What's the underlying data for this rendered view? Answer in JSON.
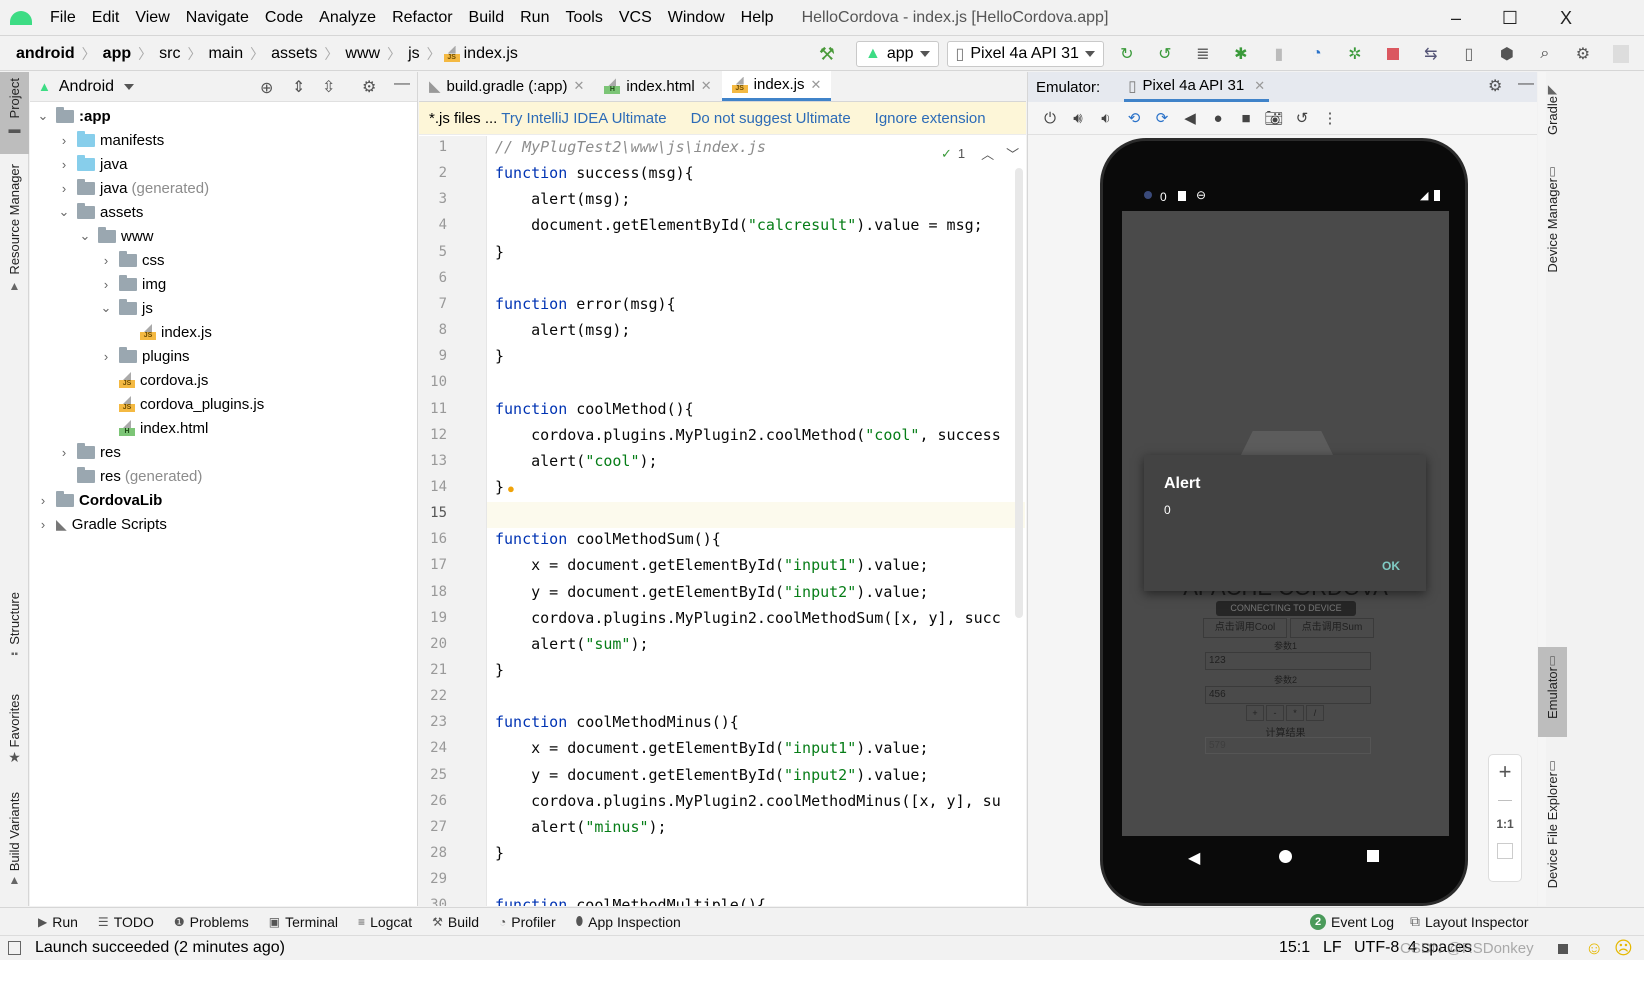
{
  "menu": [
    "File",
    "Edit",
    "View",
    "Navigate",
    "Code",
    "Analyze",
    "Refactor",
    "Build",
    "Run",
    "Tools",
    "VCS",
    "Window",
    "Help"
  ],
  "window_title": "HelloCordova - index.js [HelloCordova.app]",
  "window_controls": {
    "minimize": "–",
    "maximize": "☐",
    "close": "X"
  },
  "breadcrumb": [
    "android",
    "app",
    "src",
    "main",
    "assets",
    "www",
    "js",
    "index.js"
  ],
  "toolbar": {
    "run_config": "app",
    "device": "Pixel 4a API 31"
  },
  "left_stripe": {
    "project": "Project",
    "resource_manager": "Resource Manager",
    "structure": "Structure",
    "favorites": "Favorites",
    "build_variants": "Build Variants"
  },
  "project": {
    "view": "Android",
    "tree": [
      {
        "label": ":app",
        "level": 0,
        "chev": "v",
        "type": "module",
        "bold": true
      },
      {
        "label": "manifests",
        "level": 1,
        "chev": ">",
        "type": "blue"
      },
      {
        "label": "java",
        "level": 1,
        "chev": ">",
        "type": "blue"
      },
      {
        "label": "java",
        "suffix": "(generated)",
        "level": 1,
        "chev": ">",
        "type": "gen"
      },
      {
        "label": "assets",
        "level": 1,
        "chev": "v",
        "type": "res"
      },
      {
        "label": "www",
        "level": 2,
        "chev": "v",
        "type": "folder"
      },
      {
        "label": "css",
        "level": 3,
        "chev": ">",
        "type": "folder"
      },
      {
        "label": "img",
        "level": 3,
        "chev": ">",
        "type": "folder"
      },
      {
        "label": "js",
        "level": 3,
        "chev": "v",
        "type": "folder"
      },
      {
        "label": "index.js",
        "level": 4,
        "chev": "",
        "type": "js"
      },
      {
        "label": "plugins",
        "level": 3,
        "chev": ">",
        "type": "folder"
      },
      {
        "label": "cordova.js",
        "level": 3,
        "chev": "",
        "type": "js"
      },
      {
        "label": "cordova_plugins.js",
        "level": 3,
        "chev": "",
        "type": "js"
      },
      {
        "label": "index.html",
        "level": 3,
        "chev": "",
        "type": "html"
      },
      {
        "label": "res",
        "level": 1,
        "chev": ">",
        "type": "res"
      },
      {
        "label": "res",
        "suffix": "(generated)",
        "level": 1,
        "chev": "",
        "type": "res"
      },
      {
        "label": "CordovaLib",
        "level": 0,
        "chev": ">",
        "type": "module",
        "bold": true
      },
      {
        "label": "Gradle Scripts",
        "level": 0,
        "chev": ">",
        "type": "gradle"
      }
    ]
  },
  "editor": {
    "tabs": [
      {
        "label": "build.gradle (:app)",
        "icon": "gradle",
        "active": false
      },
      {
        "label": "index.html",
        "icon": "html",
        "active": false
      },
      {
        "label": "index.js",
        "icon": "js",
        "active": true
      }
    ],
    "banner": {
      "text": "*.js files ...",
      "link1": "Try IntelliJ IDEA Ultimate",
      "link2": "Do not suggest Ultimate",
      "link3": "Ignore extension"
    },
    "inspection_count": "1",
    "current_line": 15,
    "lines": [
      [
        {
          "t": "// MyPlugTest2\\www\\js\\index.js",
          "c": "cm"
        }
      ],
      [
        {
          "t": "function",
          "c": "kw"
        },
        {
          "t": " success(msg){"
        }
      ],
      [
        {
          "t": "    alert(msg);"
        }
      ],
      [
        {
          "t": "    document.getElementById("
        },
        {
          "t": "\"calcresult\"",
          "c": "str"
        },
        {
          "t": ").value = msg;"
        }
      ],
      [
        {
          "t": "}"
        }
      ],
      [],
      [
        {
          "t": "function",
          "c": "kw"
        },
        {
          "t": " error(msg){"
        }
      ],
      [
        {
          "t": "    alert(msg);"
        }
      ],
      [
        {
          "t": "}"
        }
      ],
      [],
      [
        {
          "t": "function",
          "c": "kw"
        },
        {
          "t": " coolMethod(){"
        }
      ],
      [
        {
          "t": "    cordova.plugins.MyPlugin2.coolMethod("
        },
        {
          "t": "\"cool\"",
          "c": "str"
        },
        {
          "t": ", success"
        }
      ],
      [
        {
          "t": "    alert("
        },
        {
          "t": "\"cool\"",
          "c": "str"
        },
        {
          "t": ");"
        }
      ],
      [
        {
          "t": "}"
        }
      ],
      [],
      [
        {
          "t": "function",
          "c": "kw"
        },
        {
          "t": " coolMethodSum(){"
        }
      ],
      [
        {
          "t": "    x = document.getElementById("
        },
        {
          "t": "\"input1\"",
          "c": "str"
        },
        {
          "t": ").value;"
        }
      ],
      [
        {
          "t": "    y = document.getElementById("
        },
        {
          "t": "\"input2\"",
          "c": "str"
        },
        {
          "t": ").value;"
        }
      ],
      [
        {
          "t": "    cordova.plugins.MyPlugin2.coolMethodSum([x, y], succ"
        }
      ],
      [
        {
          "t": "    alert("
        },
        {
          "t": "\"sum\"",
          "c": "str"
        },
        {
          "t": ");"
        }
      ],
      [
        {
          "t": "}"
        }
      ],
      [],
      [
        {
          "t": "function",
          "c": "kw"
        },
        {
          "t": " coolMethodMinus(){"
        }
      ],
      [
        {
          "t": "    x = document.getElementById("
        },
        {
          "t": "\"input1\"",
          "c": "str"
        },
        {
          "t": ").value;"
        }
      ],
      [
        {
          "t": "    y = document.getElementById("
        },
        {
          "t": "\"input2\"",
          "c": "str"
        },
        {
          "t": ").value;"
        }
      ],
      [
        {
          "t": "    cordova.plugins.MyPlugin2.coolMethodMinus([x, y], su"
        }
      ],
      [
        {
          "t": "    alert("
        },
        {
          "t": "\"minus\"",
          "c": "str"
        },
        {
          "t": ");"
        }
      ],
      [
        {
          "t": "}"
        }
      ],
      [],
      [
        {
          "t": "function",
          "c": "kw"
        },
        {
          "t": " coolMethodMultiple(){"
        }
      ]
    ]
  },
  "emulator": {
    "label": "Emulator:",
    "tab": "Pixel 4a API 31",
    "status_bar_text": "0",
    "alert": {
      "title": "Alert",
      "message": "0",
      "ok": "OK"
    },
    "app": {
      "heading": "APACHE CORDOVA",
      "status": "CONNECTING TO DEVICE",
      "btn_cool": "点击调用Cool",
      "btn_sum": "点击调用Sum",
      "param1_label": "参数1",
      "param1_value": "123",
      "param2_label": "参数2",
      "param2_value": "456",
      "ops": [
        "+",
        "-",
        "*",
        "/"
      ],
      "result_label": "计算结果",
      "result_value": "579"
    },
    "zoom": {
      "in": "+",
      "out": "—",
      "actual": "1:1"
    }
  },
  "right_stripe": {
    "gradle": "Gradle",
    "device_manager": "Device Manager",
    "emulator": "Emulator",
    "device_file_explorer": "Device File Explorer"
  },
  "bottom_tools": [
    "Run",
    "TODO",
    "Problems",
    "Terminal",
    "Logcat",
    "Build",
    "Profiler",
    "App Inspection"
  ],
  "bottom_right": {
    "event_log_count": "2",
    "event_log": "Event Log",
    "layout_inspector": "Layout Inspector"
  },
  "status": {
    "message": "Launch succeeded (2 minutes ago)",
    "position": "15:1",
    "line_sep": "LF",
    "encoding": "UTF-8",
    "indent": "4 spaces",
    "watermark": "CSDN @RSDonkey"
  }
}
